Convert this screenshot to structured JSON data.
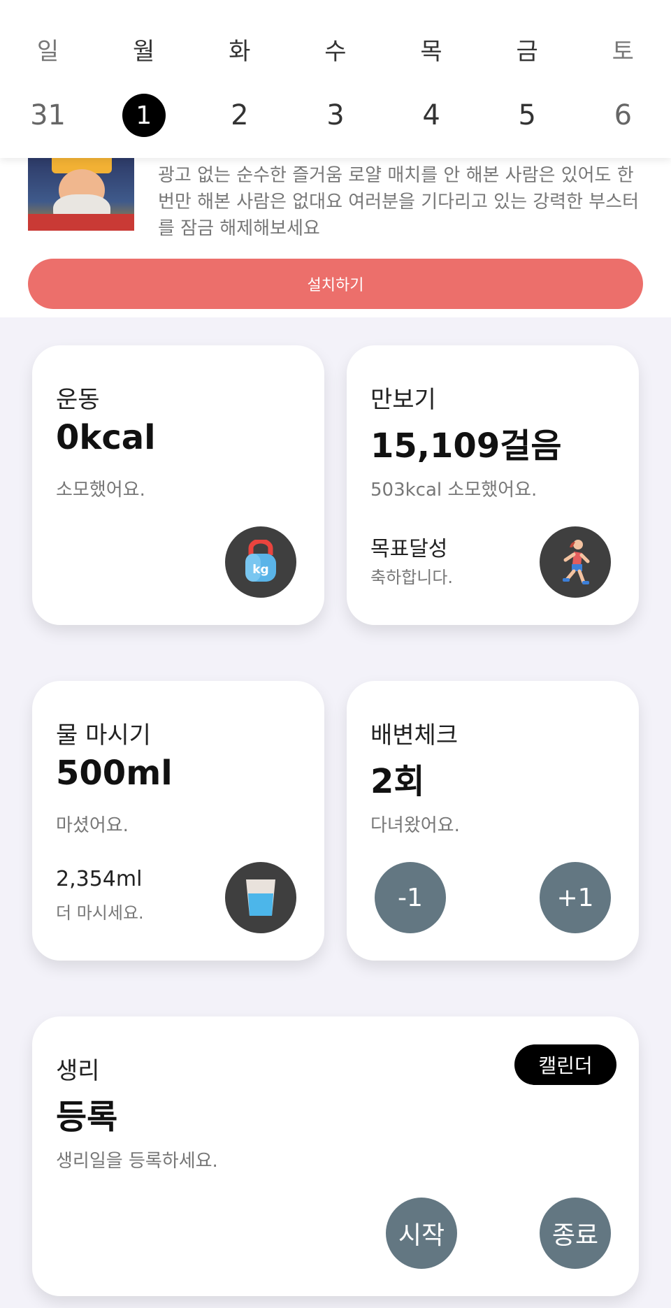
{
  "week": {
    "days": [
      "일",
      "월",
      "화",
      "수",
      "목",
      "금",
      "토"
    ],
    "dates": [
      "31",
      "1",
      "2",
      "3",
      "4",
      "5",
      "6"
    ],
    "selected_index": 1
  },
  "ad": {
    "text": "광고 없는 순수한 즐거움 로얄 매치를 안 해본 사람은 있어도 한 번만 해본 사람은 없대요 여러분을 기다리고 있는 강력한 부스터를 잠금 해제해보세요",
    "install_label": "설치하기"
  },
  "exercise": {
    "title": "운동",
    "value": "0kcal",
    "sub": "소모했어요."
  },
  "pedometer": {
    "title": "만보기",
    "value": "15,109걸음",
    "sub": "503kcal 소모했어요.",
    "goal_title": "목표달성",
    "goal_sub": "축하합니다."
  },
  "water": {
    "title": "물 마시기",
    "value": "500ml",
    "sub": "마셨어요.",
    "remain_value": "2,354ml",
    "remain_sub": "더 마시세요."
  },
  "bowel": {
    "title": "배변체크",
    "value": "2회",
    "sub": "다녀왔어요.",
    "minus_label": "-1",
    "plus_label": "+1"
  },
  "period": {
    "title": "생리",
    "value": "등록",
    "sub": "생리일을 등록하세요.",
    "calendar_label": "캘린더",
    "start_label": "시작",
    "end_label": "종료"
  },
  "icons": {
    "exercise": "kettlebell-icon",
    "pedometer": "runner-icon",
    "water": "water-glass-icon"
  },
  "colors": {
    "install_button": "#ec6f6b",
    "slate_button": "#637782",
    "dark_button": "#3f3f3f",
    "background": "#f3f2f9"
  }
}
